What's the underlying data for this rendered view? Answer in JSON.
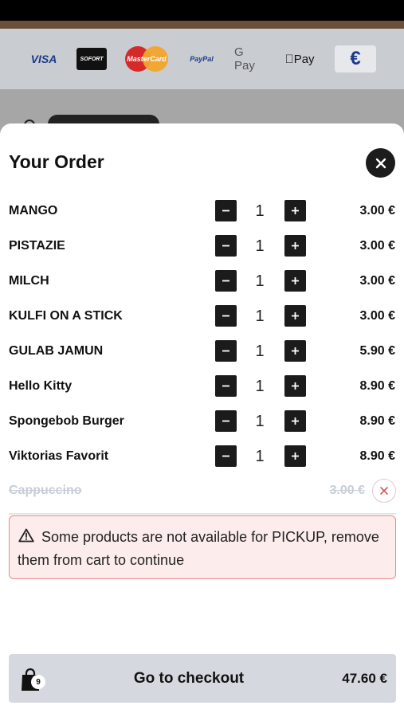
{
  "payment_methods": [
    "VISA",
    "SOFORT",
    "MasterCard",
    "PayPal",
    "G Pay",
    "Pay",
    "€"
  ],
  "order": {
    "title": "Your Order",
    "items": [
      {
        "name": "MANGO",
        "qty": "1",
        "price": "3.00 €"
      },
      {
        "name": "PISTAZIE",
        "qty": "1",
        "price": "3.00 €"
      },
      {
        "name": "MILCH",
        "qty": "1",
        "price": "3.00 €"
      },
      {
        "name": "KULFI ON A STICK",
        "qty": "1",
        "price": "3.00 €"
      },
      {
        "name": "GULAB JAMUN",
        "qty": "1",
        "price": "5.90 €"
      },
      {
        "name": "Hello Kitty",
        "qty": "1",
        "price": "8.90 €"
      },
      {
        "name": "Spongebob Burger",
        "qty": "1",
        "price": "8.90 €"
      },
      {
        "name": "Viktorias Favorit",
        "qty": "1",
        "price": "8.90 €"
      }
    ],
    "unavailable_item": {
      "name": "Cappuccino",
      "price": "3.00 €"
    },
    "warning": "Some products are not available for PICKUP, remove them from cart to continue"
  },
  "checkout": {
    "label": "Go to checkout",
    "cart_count": "9",
    "total": "47.60 €"
  },
  "colors": {
    "dark_button": "#1b1b1b",
    "warning_bg": "#fdecec",
    "warning_border": "#e98a8a",
    "checkout_bg": "#d5d9df"
  }
}
